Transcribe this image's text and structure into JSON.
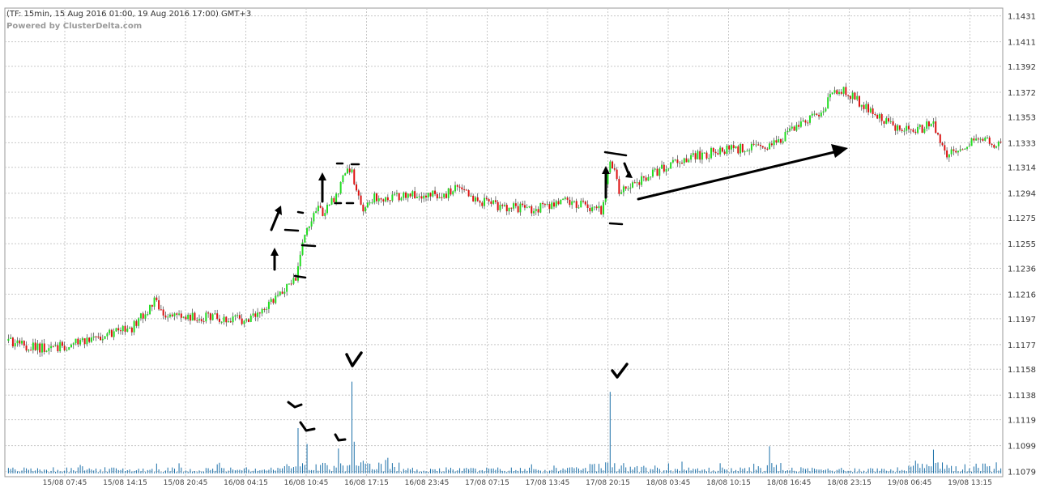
{
  "header": {
    "title": "(TF: 15min, 15 Aug 2016 01:00, 19 Aug 2016 17:00) GMT+3",
    "powered_by": "Powered by ClusterDelta.com"
  },
  "colors": {
    "up": "#22dd22",
    "down": "#dd1111",
    "wick": "#222222",
    "volume": "#1a6fa8",
    "grid": "#c8c8c8",
    "annotation": "#000000"
  },
  "chart_data": {
    "type": "candlestick",
    "timeframe": "15min",
    "y_axis": {
      "position": "right",
      "ticks": [
        "1.1431",
        "1.1411",
        "1.1392",
        "1.1372",
        "1.1353",
        "1.1333",
        "1.1314",
        "1.1294",
        "1.1275",
        "1.1255",
        "1.1236",
        "1.1216",
        "1.1197",
        "1.1177",
        "1.1158",
        "1.1138",
        "1.1119",
        "1.1099",
        "1.1079"
      ],
      "ylim": [
        1.1075,
        1.1437
      ]
    },
    "x_axis": {
      "ticks": [
        "15/08 07:45",
        "15/08 14:15",
        "15/08 20:45",
        "16/08 04:15",
        "16/08 10:45",
        "16/08 17:15",
        "16/08 23:45",
        "17/08 07:15",
        "17/08 13:45",
        "17/08 20:15",
        "18/08 03:45",
        "18/08 10:15",
        "18/08 16:45",
        "18/08 23:15",
        "19/08 06:45",
        "19/08 13:15"
      ],
      "bars_per_tick": 26
    },
    "grid": true,
    "price_path_anchors": [
      [
        0,
        1.118
      ],
      [
        10,
        1.1175
      ],
      [
        20,
        1.1174
      ],
      [
        40,
        1.1183
      ],
      [
        55,
        1.119
      ],
      [
        65,
        1.121
      ],
      [
        70,
        1.12
      ],
      [
        90,
        1.1198
      ],
      [
        108,
        1.1196
      ],
      [
        113,
        1.1205
      ],
      [
        120,
        1.1215
      ],
      [
        128,
        1.123
      ],
      [
        131,
        1.1258
      ],
      [
        134,
        1.1268
      ],
      [
        136,
        1.1282
      ],
      [
        140,
        1.128
      ],
      [
        146,
        1.129
      ],
      [
        149,
        1.131
      ],
      [
        153,
        1.1312
      ],
      [
        157,
        1.1282
      ],
      [
        162,
        1.129
      ],
      [
        180,
        1.1293
      ],
      [
        195,
        1.1293
      ],
      [
        200,
        1.1298
      ],
      [
        210,
        1.1288
      ],
      [
        220,
        1.1283
      ],
      [
        235,
        1.1282
      ],
      [
        250,
        1.1288
      ],
      [
        260,
        1.1282
      ],
      [
        264,
        1.128
      ],
      [
        266,
        1.13
      ],
      [
        268,
        1.1318
      ],
      [
        270,
        1.131
      ],
      [
        272,
        1.1295
      ],
      [
        278,
        1.13
      ],
      [
        290,
        1.1312
      ],
      [
        300,
        1.132
      ],
      [
        320,
        1.1328
      ],
      [
        340,
        1.133
      ],
      [
        350,
        1.1343
      ],
      [
        360,
        1.1355
      ],
      [
        370,
        1.1375
      ],
      [
        375,
        1.137
      ],
      [
        385,
        1.1355
      ],
      [
        395,
        1.1345
      ],
      [
        405,
        1.1343
      ],
      [
        412,
        1.1348
      ],
      [
        418,
        1.1325
      ],
      [
        425,
        1.133
      ],
      [
        432,
        1.1336
      ],
      [
        442,
        1.133
      ]
    ],
    "volume_spikes": [
      {
        "bar": 129,
        "value": 0.4
      },
      {
        "bar": 133,
        "value": 0.26
      },
      {
        "bar": 147,
        "value": 0.22
      },
      {
        "bar": 153,
        "value": 0.81
      },
      {
        "bar": 154,
        "value": 0.28
      },
      {
        "bar": 268,
        "value": 0.72
      },
      {
        "bar": 339,
        "value": 0.24
      },
      {
        "bar": 412,
        "value": 0.21
      }
    ],
    "annotations": [
      "hand-drawn-up-arrows-16-08",
      "hand-drawn-brackets-at-levels",
      "long-arrow-up-right-17-08-to-18-08",
      "checkmarks-on-volume-spikes"
    ]
  }
}
